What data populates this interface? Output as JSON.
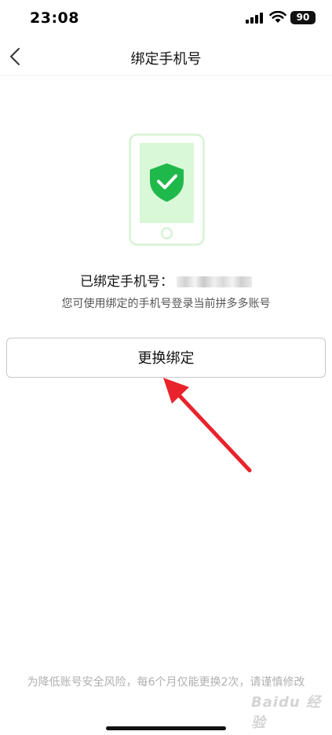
{
  "status_bar": {
    "time": "23:08",
    "battery": "90"
  },
  "nav": {
    "title": "绑定手机号"
  },
  "main": {
    "bound_label": "已绑定手机号：",
    "hint": "您可使用绑定的手机号登录当前拼多多账号",
    "change_button_label": "更换绑定"
  },
  "footer": {
    "notice": "为降低账号安全风险，每6个月仅能更换2次，请谨慎修改",
    "watermark": "Baidu 经验"
  },
  "colors": {
    "shield_green": "#1fb94b",
    "screen_green": "#d9f8d8",
    "arrow_red": "#e8232b"
  }
}
